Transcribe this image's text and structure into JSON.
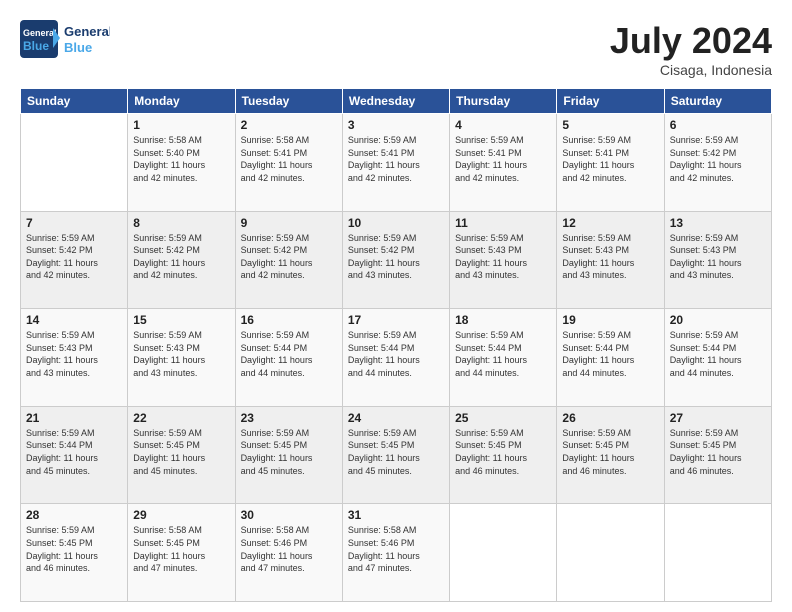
{
  "header": {
    "logo_line1": "General",
    "logo_line2": "Blue",
    "month": "July 2024",
    "location": "Cisaga, Indonesia"
  },
  "days_of_week": [
    "Sunday",
    "Monday",
    "Tuesday",
    "Wednesday",
    "Thursday",
    "Friday",
    "Saturday"
  ],
  "weeks": [
    [
      {
        "day": "",
        "text": ""
      },
      {
        "day": "1",
        "text": "Sunrise: 5:58 AM\nSunset: 5:40 PM\nDaylight: 11 hours\nand 42 minutes."
      },
      {
        "day": "2",
        "text": "Sunrise: 5:58 AM\nSunset: 5:41 PM\nDaylight: 11 hours\nand 42 minutes."
      },
      {
        "day": "3",
        "text": "Sunrise: 5:59 AM\nSunset: 5:41 PM\nDaylight: 11 hours\nand 42 minutes."
      },
      {
        "day": "4",
        "text": "Sunrise: 5:59 AM\nSunset: 5:41 PM\nDaylight: 11 hours\nand 42 minutes."
      },
      {
        "day": "5",
        "text": "Sunrise: 5:59 AM\nSunset: 5:41 PM\nDaylight: 11 hours\nand 42 minutes."
      },
      {
        "day": "6",
        "text": "Sunrise: 5:59 AM\nSunset: 5:42 PM\nDaylight: 11 hours\nand 42 minutes."
      }
    ],
    [
      {
        "day": "7",
        "text": "Sunrise: 5:59 AM\nSunset: 5:42 PM\nDaylight: 11 hours\nand 42 minutes."
      },
      {
        "day": "8",
        "text": "Sunrise: 5:59 AM\nSunset: 5:42 PM\nDaylight: 11 hours\nand 42 minutes."
      },
      {
        "day": "9",
        "text": "Sunrise: 5:59 AM\nSunset: 5:42 PM\nDaylight: 11 hours\nand 42 minutes."
      },
      {
        "day": "10",
        "text": "Sunrise: 5:59 AM\nSunset: 5:42 PM\nDaylight: 11 hours\nand 43 minutes."
      },
      {
        "day": "11",
        "text": "Sunrise: 5:59 AM\nSunset: 5:43 PM\nDaylight: 11 hours\nand 43 minutes."
      },
      {
        "day": "12",
        "text": "Sunrise: 5:59 AM\nSunset: 5:43 PM\nDaylight: 11 hours\nand 43 minutes."
      },
      {
        "day": "13",
        "text": "Sunrise: 5:59 AM\nSunset: 5:43 PM\nDaylight: 11 hours\nand 43 minutes."
      }
    ],
    [
      {
        "day": "14",
        "text": "Sunrise: 5:59 AM\nSunset: 5:43 PM\nDaylight: 11 hours\nand 43 minutes."
      },
      {
        "day": "15",
        "text": "Sunrise: 5:59 AM\nSunset: 5:43 PM\nDaylight: 11 hours\nand 43 minutes."
      },
      {
        "day": "16",
        "text": "Sunrise: 5:59 AM\nSunset: 5:44 PM\nDaylight: 11 hours\nand 44 minutes."
      },
      {
        "day": "17",
        "text": "Sunrise: 5:59 AM\nSunset: 5:44 PM\nDaylight: 11 hours\nand 44 minutes."
      },
      {
        "day": "18",
        "text": "Sunrise: 5:59 AM\nSunset: 5:44 PM\nDaylight: 11 hours\nand 44 minutes."
      },
      {
        "day": "19",
        "text": "Sunrise: 5:59 AM\nSunset: 5:44 PM\nDaylight: 11 hours\nand 44 minutes."
      },
      {
        "day": "20",
        "text": "Sunrise: 5:59 AM\nSunset: 5:44 PM\nDaylight: 11 hours\nand 44 minutes."
      }
    ],
    [
      {
        "day": "21",
        "text": "Sunrise: 5:59 AM\nSunset: 5:44 PM\nDaylight: 11 hours\nand 45 minutes."
      },
      {
        "day": "22",
        "text": "Sunrise: 5:59 AM\nSunset: 5:45 PM\nDaylight: 11 hours\nand 45 minutes."
      },
      {
        "day": "23",
        "text": "Sunrise: 5:59 AM\nSunset: 5:45 PM\nDaylight: 11 hours\nand 45 minutes."
      },
      {
        "day": "24",
        "text": "Sunrise: 5:59 AM\nSunset: 5:45 PM\nDaylight: 11 hours\nand 45 minutes."
      },
      {
        "day": "25",
        "text": "Sunrise: 5:59 AM\nSunset: 5:45 PM\nDaylight: 11 hours\nand 46 minutes."
      },
      {
        "day": "26",
        "text": "Sunrise: 5:59 AM\nSunset: 5:45 PM\nDaylight: 11 hours\nand 46 minutes."
      },
      {
        "day": "27",
        "text": "Sunrise: 5:59 AM\nSunset: 5:45 PM\nDaylight: 11 hours\nand 46 minutes."
      }
    ],
    [
      {
        "day": "28",
        "text": "Sunrise: 5:59 AM\nSunset: 5:45 PM\nDaylight: 11 hours\nand 46 minutes."
      },
      {
        "day": "29",
        "text": "Sunrise: 5:58 AM\nSunset: 5:45 PM\nDaylight: 11 hours\nand 47 minutes."
      },
      {
        "day": "30",
        "text": "Sunrise: 5:58 AM\nSunset: 5:46 PM\nDaylight: 11 hours\nand 47 minutes."
      },
      {
        "day": "31",
        "text": "Sunrise: 5:58 AM\nSunset: 5:46 PM\nDaylight: 11 hours\nand 47 minutes."
      },
      {
        "day": "",
        "text": ""
      },
      {
        "day": "",
        "text": ""
      },
      {
        "day": "",
        "text": ""
      }
    ]
  ]
}
